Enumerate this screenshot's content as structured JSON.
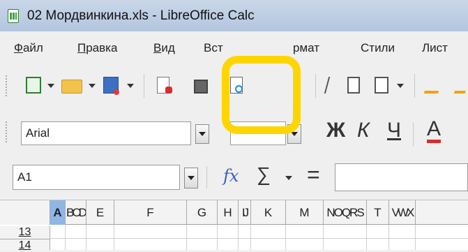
{
  "window": {
    "title": "02 Мордвинкина.xls - LibreOffice Calc",
    "app_icon": "calc-spreadsheet-icon"
  },
  "menu": {
    "items": [
      "Файл",
      "Правка",
      "Вид",
      "Вставка",
      "Формат",
      "Стили",
      "Лист"
    ],
    "visible_text": [
      {
        "pre": "",
        "u": "Ф",
        "post": "айл"
      },
      {
        "pre": "",
        "u": "П",
        "post": "равка"
      },
      {
        "pre": "",
        "u": "В",
        "post": "ид"
      },
      {
        "pre": "Вст",
        "u": "",
        "post": ""
      },
      {
        "pre": "",
        "u": "",
        "post": "рмат"
      },
      {
        "pre": "",
        "u": "",
        "post": "Стили"
      },
      {
        "pre": "",
        "u": "",
        "post": "Лист"
      }
    ]
  },
  "toolbar": {
    "icons": [
      "new-document-icon",
      "open-folder-icon",
      "save-icon",
      "export-pdf-icon",
      "print-icon",
      "print-preview-icon",
      "cut-icon",
      "copy-icon",
      "paste-icon",
      "clone-formatting-icon"
    ]
  },
  "format_toolbar": {
    "font_name": "Arial",
    "font_size": "",
    "bold_label": "Ж",
    "italic_label": "К",
    "underline_label": "Ч",
    "font_color_label": "А"
  },
  "formula_bar": {
    "name_box": "A1",
    "function_wizard": "fx",
    "sum_symbol": "∑",
    "equals_symbol": "=",
    "input_value": ""
  },
  "sheet": {
    "columns": [
      "A",
      "B",
      "C",
      "D",
      "E",
      "F",
      "G",
      "H",
      "I",
      "J",
      "K",
      "M",
      "N",
      "O",
      "Q",
      "R",
      "S",
      "T",
      "V",
      "W",
      "X"
    ],
    "header_labels": [
      "A",
      "BCD",
      "E",
      "F",
      "G",
      "H",
      "IJ",
      "K",
      "M",
      "NOQRS",
      "T",
      "VWX"
    ],
    "selected_column": "A",
    "rows": [
      "13",
      "14"
    ]
  },
  "annotation": {
    "color": "#ffd500"
  }
}
